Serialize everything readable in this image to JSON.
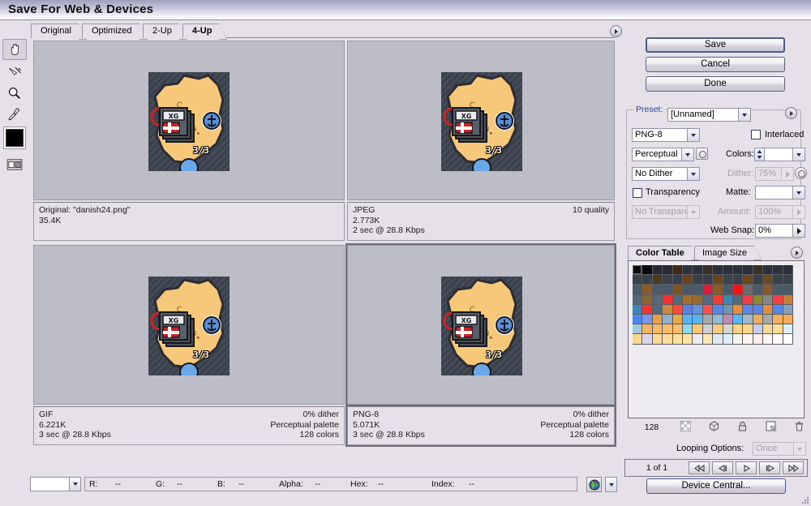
{
  "window": {
    "title": "Save For Web & Devices"
  },
  "tabs": [
    {
      "label": "Original",
      "active": false
    },
    {
      "label": "Optimized",
      "active": false
    },
    {
      "label": "2-Up",
      "active": false
    },
    {
      "label": "4-Up",
      "active": true
    }
  ],
  "tools": [
    {
      "name": "hand-tool",
      "glyph": "✋",
      "selected": true
    },
    {
      "name": "slice-select-tool",
      "glyph": "✂",
      "selected": false
    },
    {
      "name": "zoom-tool",
      "glyph": "🔍",
      "selected": false
    },
    {
      "name": "eyedropper-tool",
      "glyph": "💧",
      "selected": false
    }
  ],
  "foreground_color": "#000000",
  "previews": [
    {
      "id": "original",
      "title": "Original: \"danish24.png\"",
      "lines": [
        "35.4K"
      ],
      "right_lines": [],
      "selected": false
    },
    {
      "id": "jpeg",
      "title": "JPEG",
      "lines": [
        "2.773K",
        "2 sec @ 28.8 Kbps"
      ],
      "right_lines": [
        "10 quality"
      ],
      "selected": false
    },
    {
      "id": "gif",
      "title": "GIF",
      "lines": [
        "6.221K",
        "3 sec @ 28.8 Kbps"
      ],
      "right_lines": [
        "0% dither",
        "Perceptual palette",
        "128 colors"
      ],
      "selected": false
    },
    {
      "id": "png8",
      "title": "PNG-8",
      "lines": [
        "5.071K",
        "3 sec @ 28.8 Kbps"
      ],
      "right_lines": [
        "0% dither",
        "Perceptual palette",
        "128 colors"
      ],
      "selected": true
    }
  ],
  "image_caption": "3/3",
  "buttons": {
    "save": "Save",
    "cancel": "Cancel",
    "done": "Done",
    "device_central": "Device Central..."
  },
  "settings": {
    "preset_label": "Preset:",
    "preset_value": "[Unnamed]",
    "format_value": "PNG-8",
    "interlaced_label": "Interlaced",
    "interlaced_checked": false,
    "reduction_value": "Perceptual",
    "colors_label": "Colors:",
    "colors_value": "",
    "dither_algorithm_value": "No Dither",
    "dither_label": "Dither:",
    "dither_value": "75%",
    "dither_enabled": false,
    "transparency_label": "Transparency",
    "transparency_checked": false,
    "matte_label": "Matte:",
    "matte_value": "",
    "transparency_dither_value": "No Transparency ..",
    "transparency_dither_enabled": false,
    "amount_label": "Amount:",
    "amount_value": "100%",
    "amount_enabled": false,
    "web_snap_label": "Web Snap:",
    "web_snap_value": "0%"
  },
  "color_table": {
    "tabs": [
      {
        "label": "Color Table",
        "active": true
      },
      {
        "label": "Image Size",
        "active": false
      }
    ],
    "count": "128",
    "footer_icons": [
      "transparency-swatch-icon",
      "web-shift-icon",
      "lock-color-icon",
      "new-color-icon",
      "delete-color-icon"
    ],
    "swatches": [
      "#0b0b0c",
      "#0a0a0b",
      "#252a31",
      "#282b33",
      "#3a2a17",
      "#2c323c",
      "#2b313b",
      "#3b3026",
      "#2b313b",
      "#2a3039",
      "#2c323c",
      "#2a3039",
      "#3b3225",
      "#2b313b",
      "#2c323c",
      "#2a3039",
      "#3a4049",
      "#3a4049",
      "#4c3a22",
      "#3a4049",
      "#3a4049",
      "#66441f",
      "#3a4049",
      "#3a4049",
      "#66451f",
      "#3c424b",
      "#3a4049",
      "#6a4820",
      "#3a4049",
      "#6a4a21",
      "#3a4049",
      "#3a4049",
      "#4a5a66",
      "#8a5a27",
      "#4a5a66",
      "#4a5a66",
      "#7e5626",
      "#4a5a66",
      "#4a5a66",
      "#e21a3e",
      "#8a5a27",
      "#4a5a66",
      "#f41414",
      "#6b6b6b",
      "#4a5a66",
      "#8a5a27",
      "#4a5a66",
      "#4a5a66",
      "#55697a",
      "#8a6431",
      "#55697a",
      "#f03030",
      "#55697a",
      "#a2702f",
      "#9a6a33",
      "#55697a",
      "#f24030",
      "#3f86b6",
      "#55697a",
      "#ee4040",
      "#8c8a30",
      "#86867e",
      "#f04040",
      "#c08040",
      "#3f86b6",
      "#f23434",
      "#55697a",
      "#c88a40",
      "#fa4a3a",
      "#5a80e0",
      "#6a90d8",
      "#f65050",
      "#5a86e6",
      "#6e94b0",
      "#e09040",
      "#5a86e6",
      "#5a86e6",
      "#e09040",
      "#5a86e6",
      "#86a2b8",
      "#4a86ee",
      "#7a96e4",
      "#e8a050",
      "#90b0c8",
      "#e8a84e",
      "#5ab4f2",
      "#5ab4f2",
      "#a8a8a8",
      "#8ebcd0",
      "#c08ab4",
      "#5ab4f2",
      "#a0b8c8",
      "#eeae56",
      "#a8a8a8",
      "#f0b060",
      "#f0ae5c",
      "#9ecade",
      "#f2b460",
      "#f4ba66",
      "#f4bc6c",
      "#f6c070",
      "#90d8f4",
      "#f8c674",
      "#cdd0cb",
      "#f8cc80",
      "#d8d6cc",
      "#fad286",
      "#fad68c",
      "#c9cbe8",
      "#fcda92",
      "#fcdc98",
      "#ddf0fa",
      "#fbd68e",
      "#d9d4e6",
      "#fbd894",
      "#fcdc9a",
      "#fde0a2",
      "#fde3a8",
      "#eeeaf2",
      "#fde6b0",
      "#e2e7f4",
      "#ddeef8",
      "#f6f4f0",
      "#fbf5ee",
      "#fdf0e8",
      "#fdf6ee",
      "#fefbf6",
      "#ffffff"
    ]
  },
  "looping": {
    "label": "Looping Options:",
    "value": "Once",
    "enabled": false
  },
  "frames": {
    "counter": "1 of 1",
    "buttons": [
      "first-frame",
      "previous-frame",
      "play",
      "next-frame",
      "last-frame"
    ]
  },
  "status": {
    "zoom_value": "",
    "readout": [
      {
        "label": "R:",
        "value": "--"
      },
      {
        "label": "G:",
        "value": "--"
      },
      {
        "label": "B:",
        "value": "--"
      },
      {
        "label": "Alpha:",
        "value": "--"
      },
      {
        "label": "Hex:",
        "value": "--"
      },
      {
        "label": "Index:",
        "value": "--"
      }
    ]
  },
  "colors": {
    "window_bg": "#e6e1e8",
    "preview_bg": "#bcbdc7",
    "accent_label": "#2a3f96",
    "border": "#9a9aa4"
  }
}
